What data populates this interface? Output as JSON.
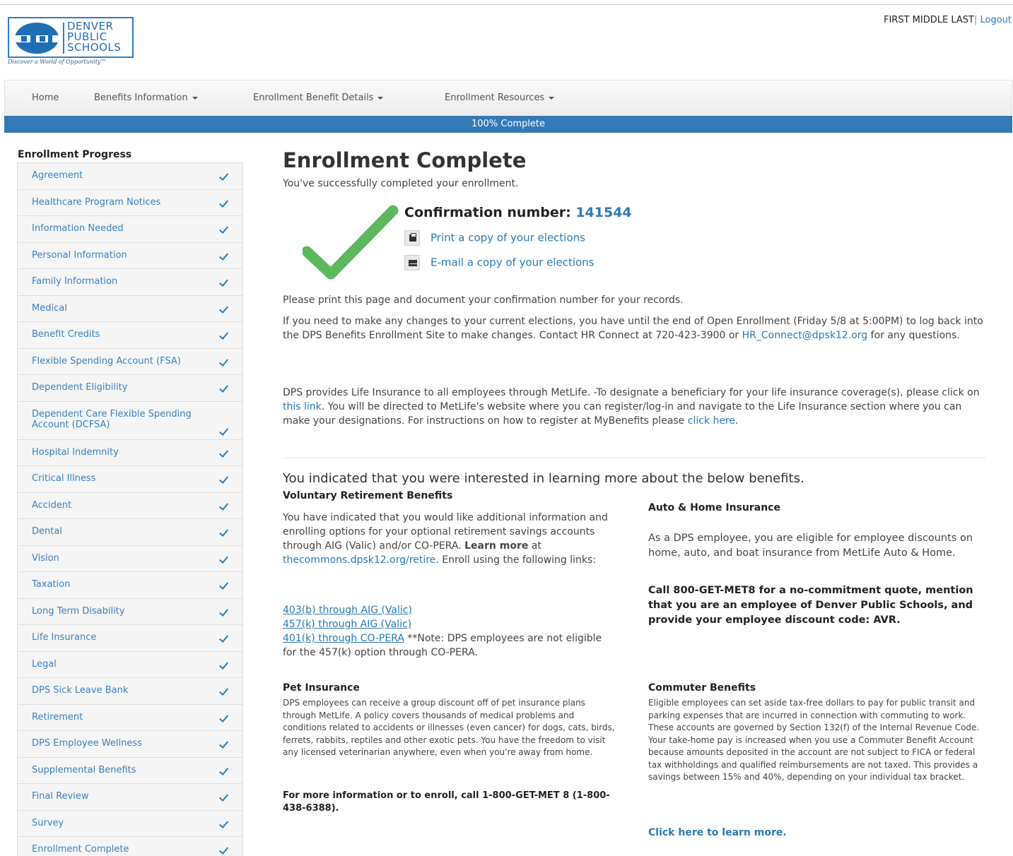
{
  "header": {
    "logo": {
      "line1": "DENVER",
      "line2": "PUBLIC",
      "line3": "SCHOOLS",
      "tagline": "Discover a World of Opportunity™"
    },
    "user_name": "FIRST MIDDLE LAST",
    "separator": "|",
    "logout_label": "Logout"
  },
  "nav": {
    "items": [
      {
        "label": "Home"
      },
      {
        "label": "Benefits Information"
      },
      {
        "label": "Enrollment Benefit Details"
      },
      {
        "label": "Enrollment Resources"
      }
    ]
  },
  "progress": {
    "label": "100% Complete",
    "percent": 100,
    "color": "#337ab7"
  },
  "sidebar": {
    "title": "Enrollment Progress",
    "items": [
      {
        "label": "Agreement"
      },
      {
        "label": "Healthcare Program Notices"
      },
      {
        "label": "Information Needed"
      },
      {
        "label": "Personal Information"
      },
      {
        "label": "Family Information"
      },
      {
        "label": "Medical"
      },
      {
        "label": "Benefit Credits"
      },
      {
        "label": "Flexible Spending Account (FSA)"
      },
      {
        "label": "Dependent Eligibility"
      },
      {
        "label": "Dependent Care Flexible Spending Account (DCFSA)"
      },
      {
        "label": "Hospital Indemnity"
      },
      {
        "label": "Critical Illness"
      },
      {
        "label": "Accident"
      },
      {
        "label": "Dental"
      },
      {
        "label": "Vision"
      },
      {
        "label": "Taxation"
      },
      {
        "label": "Long Term Disability"
      },
      {
        "label": "Life Insurance"
      },
      {
        "label": "Legal"
      },
      {
        "label": "DPS Sick Leave Bank"
      },
      {
        "label": "Retirement"
      },
      {
        "label": "DPS Employee Wellness"
      },
      {
        "label": "Supplemental Benefits"
      },
      {
        "label": "Final Review"
      },
      {
        "label": "Survey"
      },
      {
        "label": "Enrollment Complete"
      }
    ]
  },
  "main": {
    "title": "Enrollment Complete",
    "subtitle": "You've successfully completed your enrollment.",
    "confirmation_label": "Confirmation number:",
    "confirmation_number": "141544",
    "print_label": "Print a copy of your elections",
    "email_label": "E-mail a copy of your elections",
    "print_notice": "Please print this page and document your confirmation number for your records.",
    "changes_text_1": "If you need to make any changes to your current elections, you have until the end of Open Enrollment (Friday 5/8 at 5:00PM) to log back into the DPS Benefits Enrollment Site to make changes. Contact HR Connect at 720-423-3900 or ",
    "changes_email": "HR_Connect@dpsk12.org",
    "changes_text_2": " for any questions.",
    "life_text_1": "DPS provides Life Insurance to all employees through MetLife. -To designate a beneficiary for your life insurance coverage(s), please click on ",
    "life_link": "this link",
    "life_text_2": ". You will be directed to MetLife's website where you can register/log-in and navigate to the Life Insurance section where you can make your designations.  For instructions on how to register at MyBenefits please ",
    "life_link2": "click here",
    "life_text_3": ".",
    "interest_heading": "You indicated that you were interested in learning more about the below benefits.",
    "retirement": {
      "title": "Voluntary Retirement Benefits",
      "text_1": "You have indicated that you would like additional information and enrolling options for your optional retirement savings accounts through AIG (Valic) and/or CO-PERA. ",
      "learn_more": "Learn more",
      "text_2": " at ",
      "url": "thecommons.dpsk12.org/retire",
      "text_3": ". Enroll using the following links:",
      "link_403b": "403(b) through AIG (Valic)",
      "link_457k": "457(k) through AIG (Valic)",
      "link_401k": "401(k) through CO-PERA",
      "note": " **Note: DPS employees are not eligible for the 457(k) option through CO-PERA."
    },
    "auto_home": {
      "title": "Auto & Home Insurance",
      "text": "As a DPS employee, you are eligible for employee discounts on home, auto, and boat insurance from MetLife Auto & Home.",
      "bold": "Call 800-GET-MET8 for a no-commitment quote, mention that you are an employee of Denver Public Schools, and provide your employee discount code: AVR."
    },
    "pet": {
      "title": "Pet Insurance",
      "text": "DPS employees can receive a group discount off of pet insurance plans through MetLife. A policy covers thousands of medical problems and conditions related to accidents or illnesses (even cancer) for dogs, cats, birds, ferrets, rabbits, reptiles and other exotic pets. You have the freedom to visit any licensed veterinarian anywhere, even when you're away from home.",
      "bold": "For more information or to enroll, call 1-800-GET-MET 8 (1-800-438-6388)."
    },
    "commuter": {
      "title": "Commuter Benefits",
      "text": "Eligible employees can set aside tax-free dollars to pay for public transit and parking expenses that are incurred in connection with commuting to work. These accounts are governed by Section 132(f) of the Internal Revenue Code. Your take-home pay is increased when you use a Commuter Benefit Account because amounts deposited in the account are not subject to FICA or federal tax withholdings and qualified reimbursements are not taxed. This provides a savings between 15% and 40%, depending on your individual tax bracket.",
      "link": "Click here to learn more."
    }
  }
}
